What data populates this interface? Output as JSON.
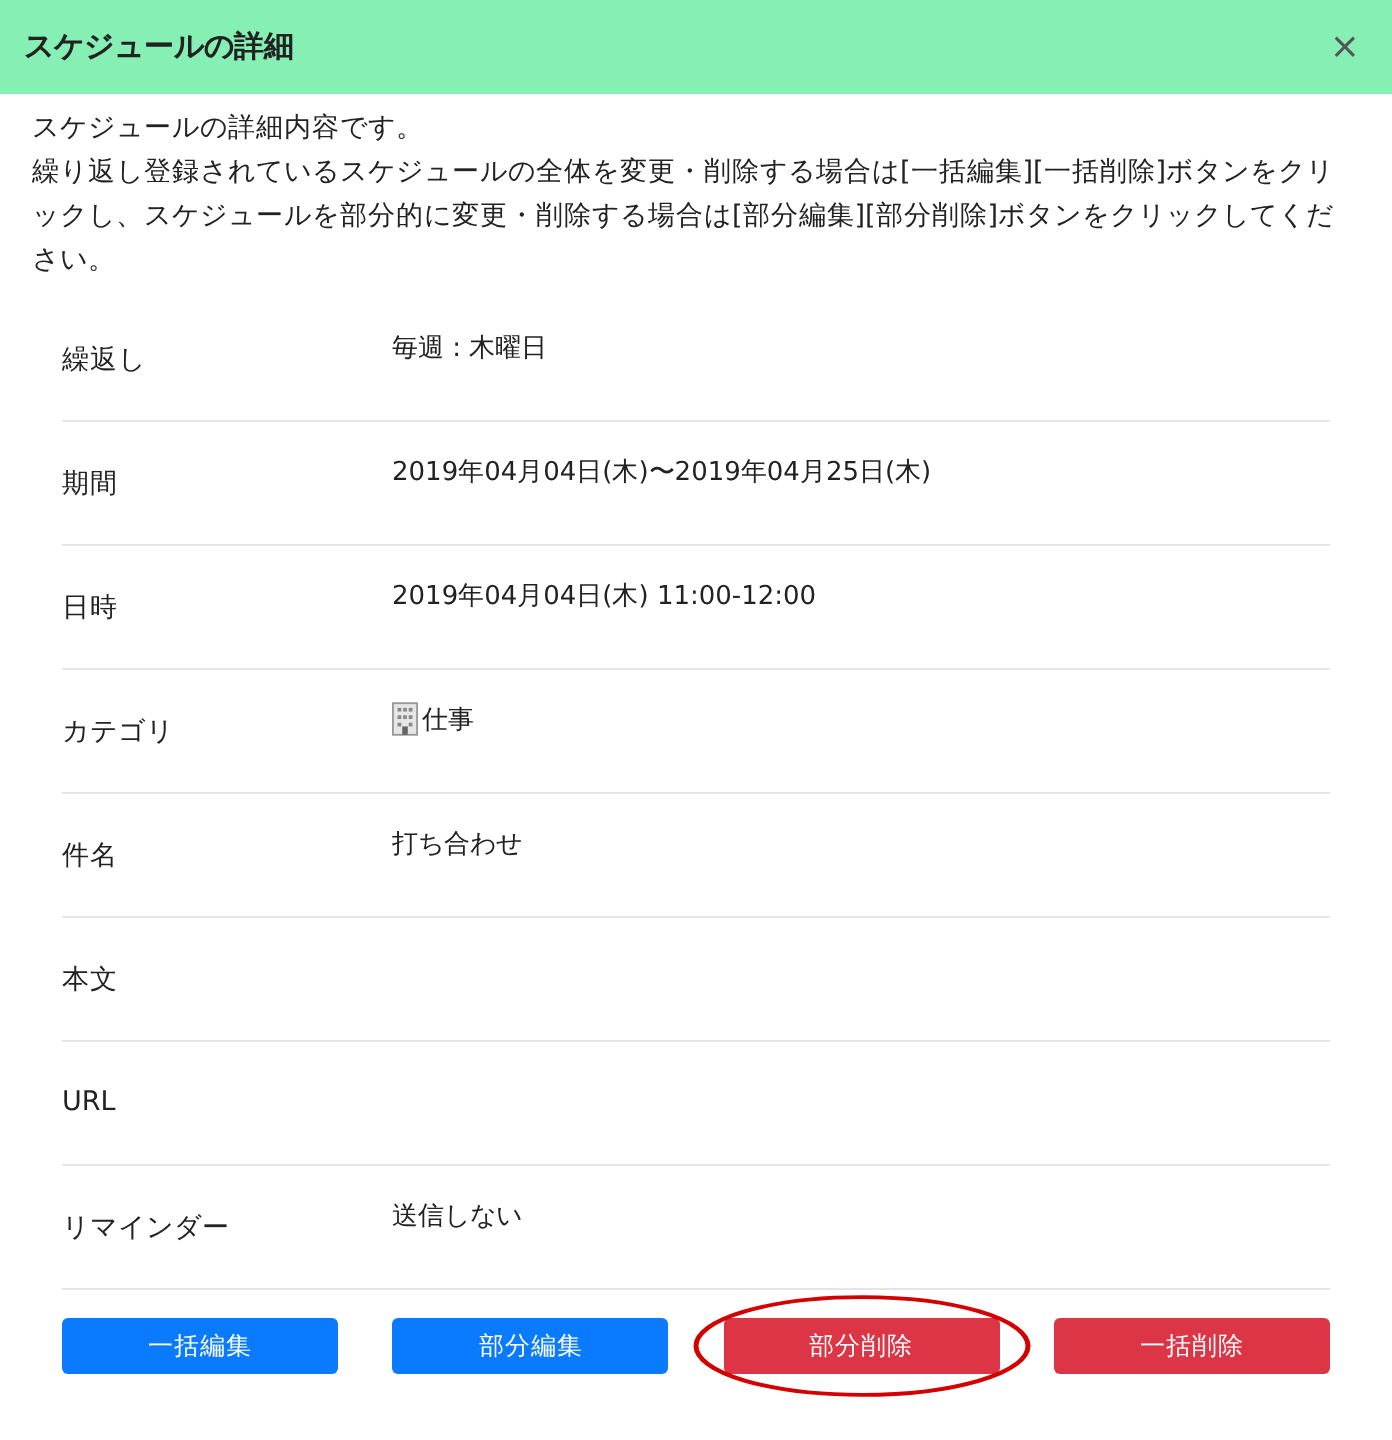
{
  "dialog": {
    "title": "スケジュールの詳細",
    "close": "×"
  },
  "description": [
    "スケジュールの詳細内容です。",
    "繰り返し登録されているスケジュールの全体を変更・削除する場合は[一括編集][一括削除]ボタンをクリックし、スケジュールを部分的に変更・削除する場合は[部分編集][部分削除]ボタンをクリックしてください。"
  ],
  "rows": [
    {
      "label": "繰返し",
      "value": "毎週 : 木曜日",
      "kind": "text"
    },
    {
      "label": "期間",
      "value": "2019年04月04日(木)〜2019年04月25日(木)",
      "kind": "text"
    },
    {
      "label": "日時",
      "value": "2019年04月04日(木) 11:00-12:00",
      "kind": "text"
    },
    {
      "label": "カテゴリ",
      "value": "仕事",
      "kind": "category"
    },
    {
      "label": "件名",
      "value": "打ち合わせ",
      "kind": "text"
    },
    {
      "label": "本文",
      "kind": "text"
    },
    {
      "label": "URL",
      "kind": "text"
    },
    {
      "label": "リマインダー",
      "value": "送信しない",
      "kind": "text"
    }
  ],
  "buttons": [
    {
      "label": "一括編集",
      "kind": "primary",
      "highlighted": false
    },
    {
      "label": "部分編集",
      "kind": "primary",
      "highlighted": false
    },
    {
      "label": "部分削除",
      "kind": "danger",
      "highlighted": true
    },
    {
      "label": "一括削除",
      "kind": "danger",
      "highlighted": false
    }
  ]
}
